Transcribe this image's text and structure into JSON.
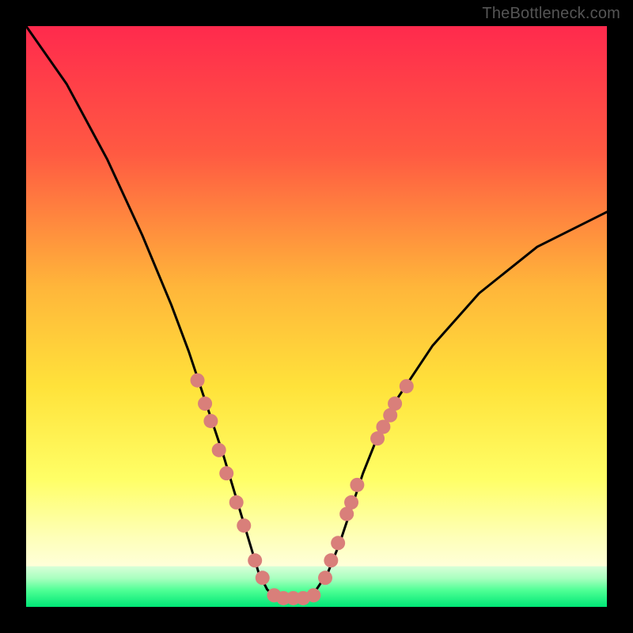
{
  "attribution": "TheBottleneck.com",
  "colors": {
    "frame": "#000000",
    "gradient_top": "#ff2a4d",
    "gradient_mid1": "#ff6a3a",
    "gradient_mid2": "#ffd23a",
    "gradient_mid3": "#ffff66",
    "gradient_mid4": "#feffb8",
    "gradient_bottom": "#ffffe0",
    "band_green_light": "#a8ffbf",
    "band_green_mid": "#4dff94",
    "band_green_dark": "#00e676",
    "curve": "#000000",
    "markers": "#d97f7a"
  },
  "chart_data": {
    "type": "line",
    "title": "",
    "xlabel": "",
    "ylabel": "",
    "xlim": [
      0,
      100
    ],
    "ylim": [
      0,
      100
    ],
    "series": [
      {
        "name": "left_curve",
        "x": [
          0,
          7,
          14,
          20,
          25,
          28,
          30,
          32,
          34,
          35.5,
          37,
          38.5,
          40,
          41.5,
          43
        ],
        "y": [
          100,
          90,
          77,
          64,
          52,
          44,
          38,
          32,
          26,
          21,
          16,
          11,
          6,
          3,
          1.5
        ]
      },
      {
        "name": "right_curve",
        "x": [
          48,
          50,
          52,
          54,
          56,
          58,
          60,
          64,
          70,
          78,
          88,
          100
        ],
        "y": [
          1.5,
          3,
          6,
          11,
          17,
          23,
          28,
          36,
          45,
          54,
          62,
          68
        ]
      },
      {
        "name": "bottom_flat",
        "x": [
          43,
          48
        ],
        "y": [
          1.5,
          1.5
        ]
      }
    ],
    "markers": [
      {
        "x": 29.5,
        "y": 39
      },
      {
        "x": 30.8,
        "y": 35
      },
      {
        "x": 31.8,
        "y": 32
      },
      {
        "x": 33.2,
        "y": 27
      },
      {
        "x": 34.5,
        "y": 23
      },
      {
        "x": 36.2,
        "y": 18
      },
      {
        "x": 37.5,
        "y": 14
      },
      {
        "x": 39.4,
        "y": 8
      },
      {
        "x": 40.7,
        "y": 5
      },
      {
        "x": 42.7,
        "y": 2
      },
      {
        "x": 44.3,
        "y": 1.5
      },
      {
        "x": 46.0,
        "y": 1.5
      },
      {
        "x": 47.7,
        "y": 1.5
      },
      {
        "x": 49.5,
        "y": 2
      },
      {
        "x": 51.5,
        "y": 5
      },
      {
        "x": 52.5,
        "y": 8
      },
      {
        "x": 53.7,
        "y": 11
      },
      {
        "x": 55.2,
        "y": 16
      },
      {
        "x": 56.0,
        "y": 18
      },
      {
        "x": 57.0,
        "y": 21
      },
      {
        "x": 60.5,
        "y": 29
      },
      {
        "x": 61.5,
        "y": 31
      },
      {
        "x": 62.7,
        "y": 33
      },
      {
        "x": 63.5,
        "y": 35
      },
      {
        "x": 65.5,
        "y": 38
      }
    ],
    "green_band_height_pct": 7.0
  }
}
